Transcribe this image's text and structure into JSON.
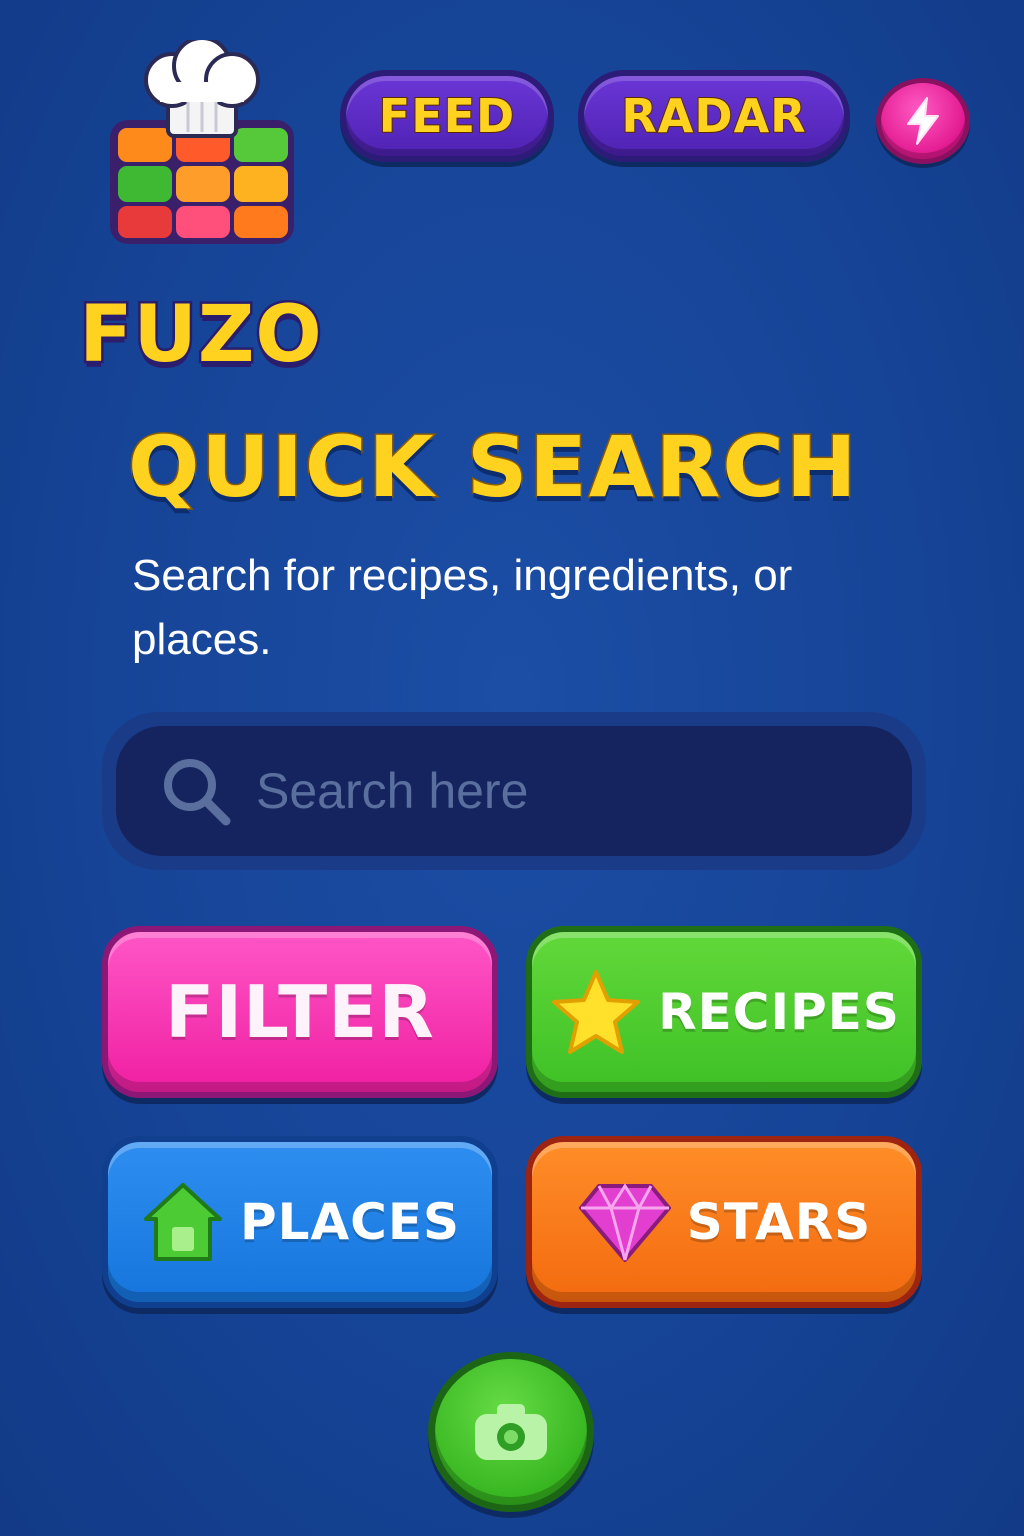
{
  "app": {
    "logo_text": "FUZO",
    "logo_icon": "chef-hat-cube-icon"
  },
  "nav": {
    "feed_label": "FEED",
    "radar_label": "RADAR",
    "bolt_icon": "lightning-bolt-icon"
  },
  "main": {
    "title": "QUICK SEARCH",
    "subtitle": "Search for recipes, ingredients, or places."
  },
  "search": {
    "placeholder": "Search here",
    "value": "",
    "icon": "search-icon"
  },
  "actions": {
    "filter_label": "FILTER",
    "recipes_label": "RECIPES",
    "recipes_icon": "star-icon",
    "places_label": "PLACES",
    "places_icon": "home-icon",
    "stars_label": "STARS",
    "stars_icon": "gem-icon"
  },
  "camera": {
    "icon": "camera-icon"
  },
  "colors": {
    "background": "#164497",
    "accent_yellow": "#ffd21f",
    "nav_purple": "#5a2cc4",
    "filter_pink": "#f22aa8",
    "recipes_green": "#46c52b",
    "places_blue": "#1f7fe4",
    "stars_orange": "#f77716"
  }
}
